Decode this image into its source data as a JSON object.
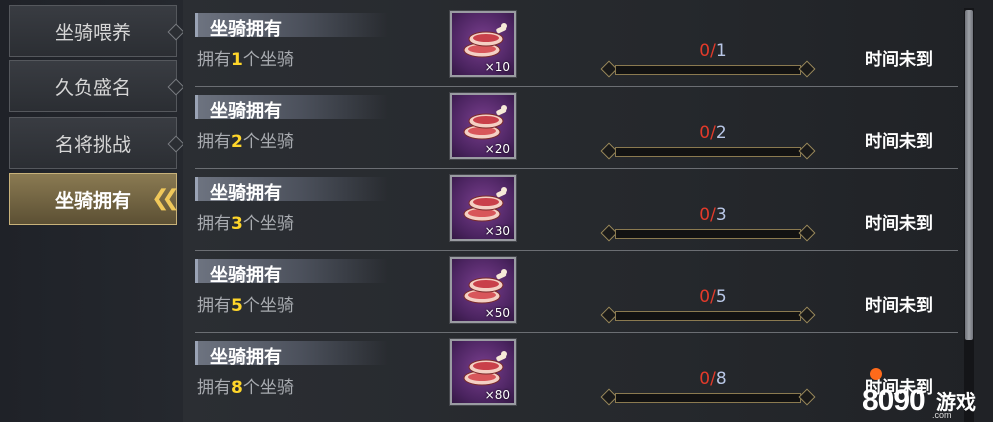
{
  "sidebar": {
    "items": [
      {
        "label": "坐骑喂养",
        "active": false
      },
      {
        "label": "久负盛名",
        "active": false
      },
      {
        "label": "名将挑战",
        "active": false
      },
      {
        "label": "坐骑拥有",
        "active": true
      }
    ]
  },
  "achievements": [
    {
      "title": "坐骑拥有",
      "desc_prefix": "拥有",
      "desc_number": "1",
      "desc_suffix": "个坐骑",
      "reward_icon": "meat-icon",
      "reward_qty": "×10",
      "progress_current": "0",
      "progress_sep": "/",
      "progress_total": "1",
      "progress_fraction": 0,
      "status": "时间未到"
    },
    {
      "title": "坐骑拥有",
      "desc_prefix": "拥有",
      "desc_number": "2",
      "desc_suffix": "个坐骑",
      "reward_icon": "meat-icon",
      "reward_qty": "×20",
      "progress_current": "0",
      "progress_sep": "/",
      "progress_total": "2",
      "progress_fraction": 0,
      "status": "时间未到"
    },
    {
      "title": "坐骑拥有",
      "desc_prefix": "拥有",
      "desc_number": "3",
      "desc_suffix": "个坐骑",
      "reward_icon": "meat-icon",
      "reward_qty": "×30",
      "progress_current": "0",
      "progress_sep": "/",
      "progress_total": "3",
      "progress_fraction": 0,
      "status": "时间未到"
    },
    {
      "title": "坐骑拥有",
      "desc_prefix": "拥有",
      "desc_number": "5",
      "desc_suffix": "个坐骑",
      "reward_icon": "meat-icon",
      "reward_qty": "×50",
      "progress_current": "0",
      "progress_sep": "/",
      "progress_total": "5",
      "progress_fraction": 0,
      "status": "时间未到"
    },
    {
      "title": "坐骑拥有",
      "desc_prefix": "拥有",
      "desc_number": "8",
      "desc_suffix": "个坐骑",
      "reward_icon": "meat-icon",
      "reward_qty": "×80",
      "progress_current": "0",
      "progress_sep": "/",
      "progress_total": "8",
      "progress_fraction": 0,
      "status": "时间未到"
    }
  ],
  "watermark": {
    "digits": "8090",
    "word": "游戏",
    "sub": ".com"
  },
  "colors": {
    "accent_gold": "#ffd62a",
    "progress_current": "#e23a2a",
    "progress_total": "#b9c7e6",
    "active_tab": "#8a7a52",
    "reward_bg": "#4b2460"
  }
}
